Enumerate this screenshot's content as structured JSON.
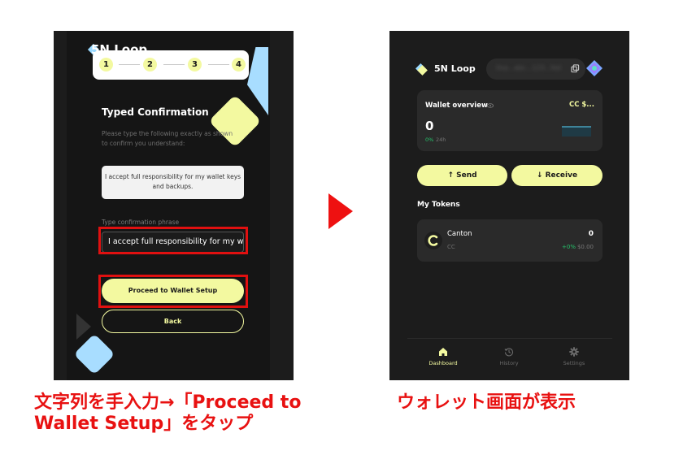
{
  "left": {
    "logo": "5N Loop",
    "steps": [
      "1",
      "2",
      "3",
      "4"
    ],
    "title": "Typed Confirmation",
    "description": "Please type the following exactly as shown to confirm you understand:",
    "phrase": "I accept full responsibility for my wallet keys and backups.",
    "input_label": "Type confirmation phrase",
    "input_value": "I accept full responsibility for my wa",
    "proceed_label": "Proceed to Wallet Setup",
    "back_label": "Back"
  },
  "right": {
    "logo": "5N Loop",
    "address": "0xa...abc...123...fed",
    "overview": {
      "title": "Wallet overview",
      "currency": "CC $...",
      "balance": "0",
      "change": "0%",
      "period": "24h"
    },
    "send_label": "↑  Send",
    "receive_label": "↓  Receive",
    "tokens_heading": "My Tokens",
    "token": {
      "name": "Canton",
      "symbol": "CC",
      "balance": "0",
      "change": "+0%",
      "usd": "$0.00"
    },
    "nav": [
      {
        "label": "Dashboard",
        "icon": "home-icon"
      },
      {
        "label": "History",
        "icon": "history-icon"
      },
      {
        "label": "Settings",
        "icon": "gear-icon"
      }
    ]
  },
  "captions": {
    "left": "文字列を手入力→「Proceed to Wallet Setup」をタップ",
    "right": "ウォレット画面が表示"
  },
  "colors": {
    "accent": "#f3f9a0",
    "highlight": "#e01010",
    "positive": "#26c36b",
    "panel_bg": "#1c1c1c"
  }
}
